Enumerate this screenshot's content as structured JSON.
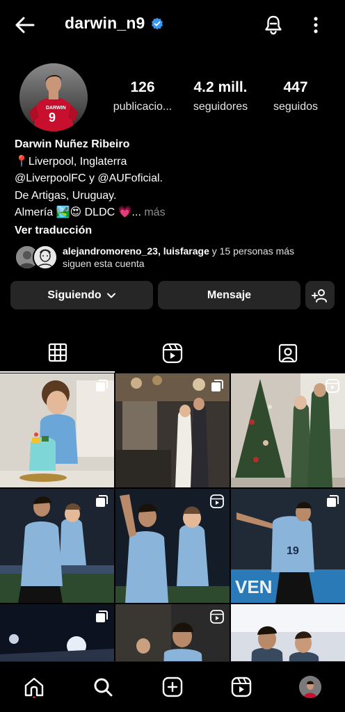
{
  "header": {
    "username": "darwin_n9",
    "verified": true
  },
  "profile": {
    "stats": [
      {
        "value": "126",
        "label": "publicacio..."
      },
      {
        "value": "4.2 mill.",
        "label": "seguidores"
      },
      {
        "value": "447",
        "label": "seguidos"
      }
    ],
    "name": "Darwin Nuñez Ribeiro",
    "bio_lines": [
      "📍Liverpool, Inglaterra",
      "@LiverpoolFC y @AUFoficial.",
      "De Artigas, Uruguay.",
      "Almería 🏞️😍 DLDC 💗..."
    ],
    "bio_more": "más",
    "translate": "Ver traducción"
  },
  "followed_by": {
    "names": "alejandromoreno_23, luisfarage",
    "rest": " y 15 personas más",
    "line2": "siguen esta cuenta"
  },
  "actions": {
    "following_label": "Siguiendo",
    "message_label": "Mensaje"
  },
  "tabs": [
    {
      "icon": "grid-icon",
      "active": true
    },
    {
      "icon": "reels-icon",
      "active": false
    },
    {
      "icon": "tagged-icon",
      "active": false
    }
  ],
  "grid": [
    {
      "subject": "child-with-cake",
      "badge": "multi-photo-icon"
    },
    {
      "subject": "couple-party",
      "badge": "multi-photo-icon"
    },
    {
      "subject": "family-christmas",
      "badge": "reel-icon"
    },
    {
      "subject": "player-with-child",
      "badge": "multi-photo-icon"
    },
    {
      "subject": "player-carrying-child",
      "badge": "reel-icon"
    },
    {
      "subject": "player-celebrating",
      "badge": "multi-photo-icon"
    },
    {
      "subject": "stadium-lights",
      "badge": "multi-photo-icon"
    },
    {
      "subject": "player-portrait",
      "badge": "reel-icon"
    },
    {
      "subject": "teammates",
      "badge": "none"
    }
  ],
  "colors": {
    "background": "#000000",
    "button": "#262626",
    "verified": "#3897f0",
    "muted": "#8e8e8e",
    "jersey_red": "#c8102e",
    "uruguay_blue": "#8ab4d9"
  }
}
